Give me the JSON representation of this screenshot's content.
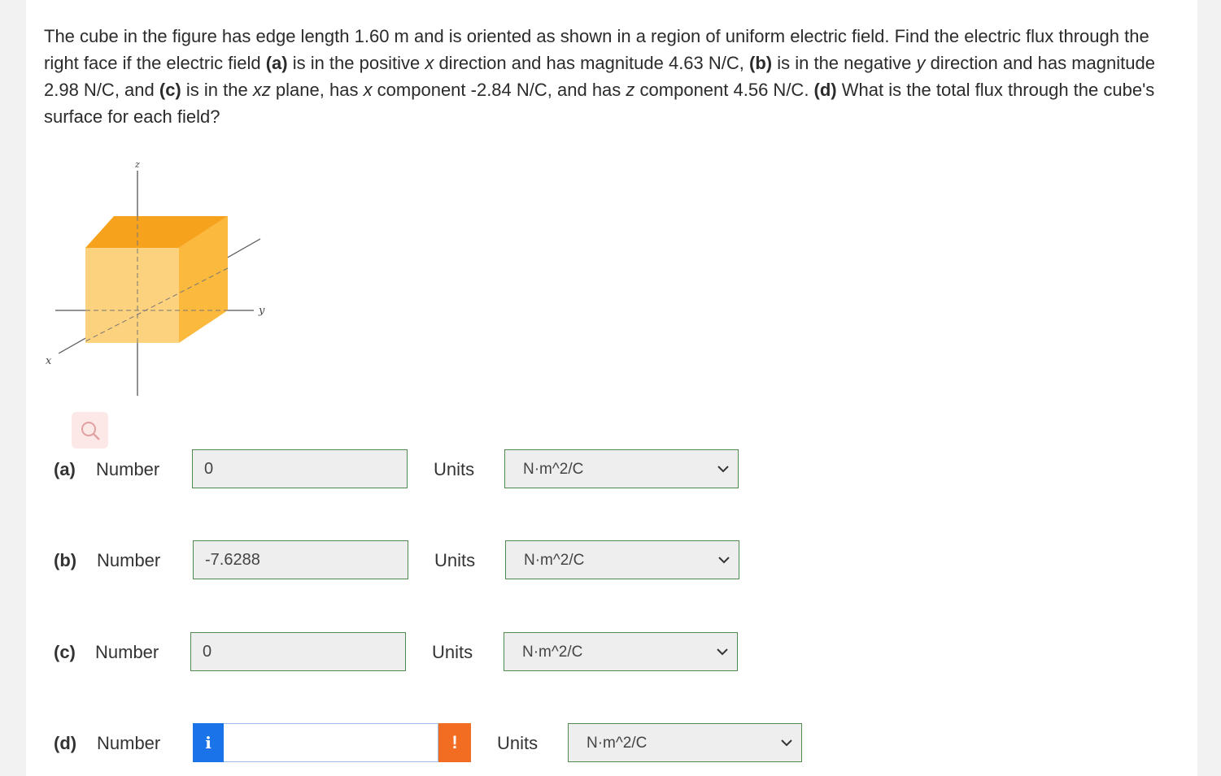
{
  "question": {
    "t1": "The cube in the figure has edge length 1.60 m and is oriented as shown in a region of uniform electric field. Find the electric flux through the right face if the electric field ",
    "a_tag": "(a)",
    "t2": " is in the positive ",
    "x1": "x",
    "t3": " direction and has magnitude 4.63 N/C, ",
    "b_tag": "(b)",
    "t4": " is in the negative ",
    "y1": "y",
    "t5": " direction and has magnitude 2.98 N/C, and ",
    "c_tag": "(c)",
    "t6": " is in the ",
    "xz": "xz",
    "t7": " plane, has ",
    "x2": "x",
    "t8": " component -2.84 N/C, and has ",
    "z1": "z",
    "t9": " component 4.56 N/C. ",
    "d_tag": "(d)",
    "t10": " What is the total flux through the cube's surface for each field?"
  },
  "figure": {
    "axis_z": "z",
    "axis_y": "y",
    "axis_x": "x",
    "cube_color": "#fcb233",
    "icon": "magnifier-icon"
  },
  "parts": [
    {
      "tag": "(a)",
      "number_label": "Number",
      "value": "0",
      "units_label": "Units",
      "units": "N·m^2/C"
    },
    {
      "tag": "(b)",
      "number_label": "Number",
      "value": "-7.6288",
      "units_label": "Units",
      "units": "N·m^2/C"
    },
    {
      "tag": "(c)",
      "number_label": "Number",
      "value": "0",
      "units_label": "Units",
      "units": "N·m^2/C"
    },
    {
      "tag": "(d)",
      "number_label": "Number",
      "value": "",
      "units_label": "Units",
      "units": "N·m^2/C",
      "info_icon": "i",
      "warn_icon": "!"
    }
  ],
  "colors": {
    "input_border": "#4f8a4f",
    "info_blue": "#1a73e8",
    "warning_orange": "#f26d21"
  }
}
